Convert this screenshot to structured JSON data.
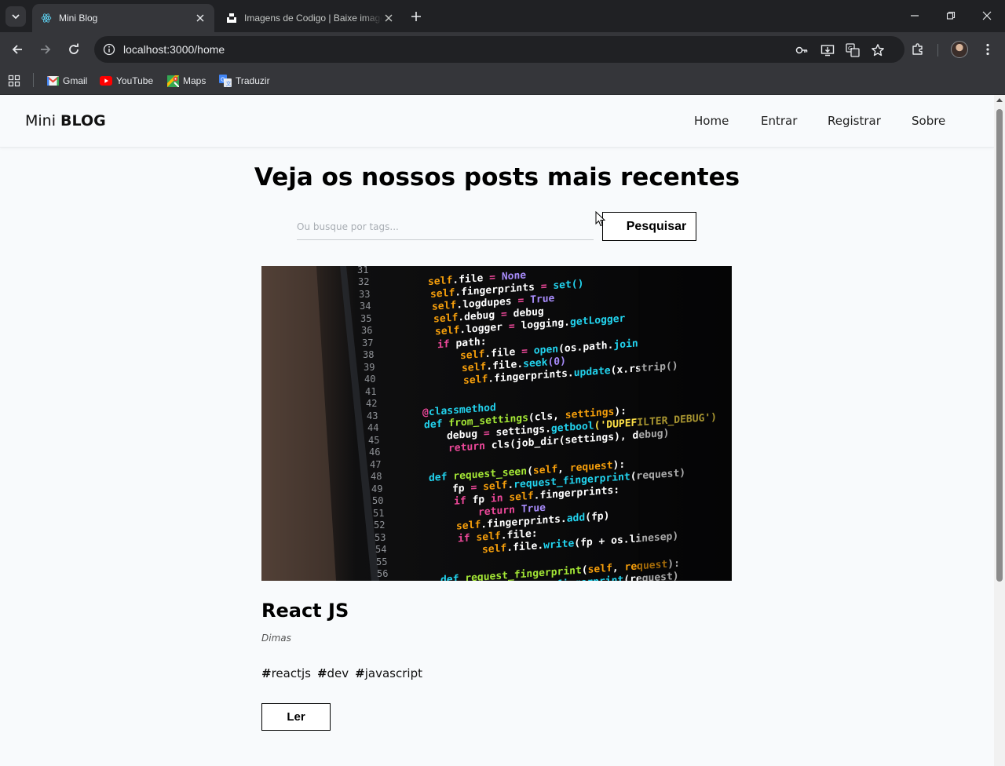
{
  "browser": {
    "tabs": [
      {
        "title": "Mini Blog",
        "favicon": "react-icon",
        "active": true
      },
      {
        "title": "Imagens de Codigo | Baixe imagens",
        "favicon": "unsplash-icon",
        "active": false
      }
    ],
    "address": {
      "url": "localhost:3000/home"
    },
    "bookmarks": [
      {
        "label": "Gmail",
        "icon": "gmail-icon"
      },
      {
        "label": "YouTube",
        "icon": "youtube-icon"
      },
      {
        "label": "Maps",
        "icon": "maps-icon"
      },
      {
        "label": "Traduzir",
        "icon": "translate-icon"
      }
    ]
  },
  "site": {
    "brand": {
      "light": "Mini",
      "bold": "BLOG"
    },
    "nav": [
      {
        "label": "Home"
      },
      {
        "label": "Entrar"
      },
      {
        "label": "Registrar"
      },
      {
        "label": "Sobre"
      }
    ]
  },
  "home": {
    "heading": "Veja os nossos posts mais recentes",
    "search": {
      "placeholder": "Ou busque por tags...",
      "value": "",
      "button_label": "Pesquisar"
    }
  },
  "post": {
    "image_alt": "code-screenshot",
    "title": "React JS",
    "author": "Dimas",
    "tags": [
      {
        "hash": "#",
        "text": "reactjs"
      },
      {
        "hash": "#",
        "text": "dev"
      },
      {
        "hash": "#",
        "text": "javascript"
      }
    ],
    "read_label": "Ler"
  },
  "colors": {
    "page_bg": "#f8fafc",
    "chrome_dark": "#202124",
    "chrome_mid": "#35363a",
    "text": "#000000"
  }
}
